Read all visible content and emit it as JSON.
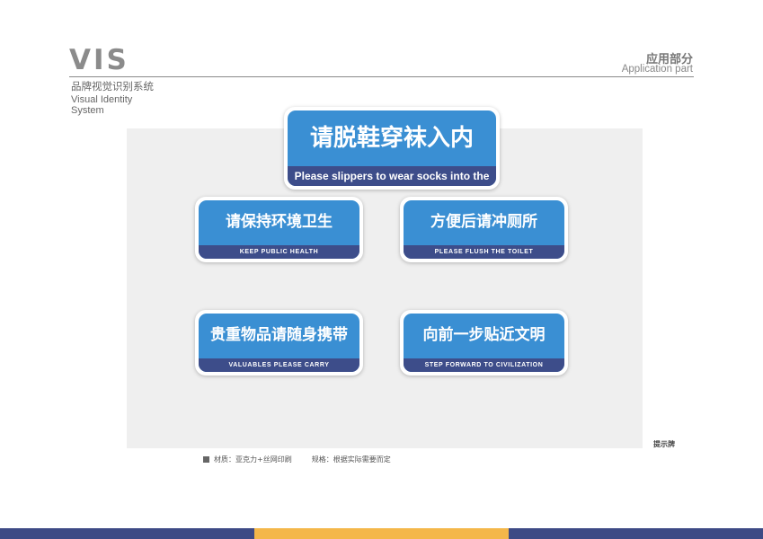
{
  "header": {
    "logo": "VIS",
    "subtitle_cn": "品牌视觉识别系统",
    "subtitle_en_1": "Visual Identity",
    "subtitle_en_2": "System",
    "section_cn": "应用部分",
    "section_en": "Application part"
  },
  "signs": [
    {
      "cn": "请脱鞋穿袜入内",
      "en": "Please slippers to wear socks into the"
    },
    {
      "cn": "请保持环境卫生",
      "en": "KEEP PUBLIC HEALTH"
    },
    {
      "cn": "方便后请冲厕所",
      "en": "PLEASE FLUSH THE TOILET"
    },
    {
      "cn": "贵重物品请随身携带",
      "en": "VALUABLES PLEASE CARRY"
    },
    {
      "cn": "向前一步贴近文明",
      "en": "STEP FORWARD TO CIVILIZATION"
    }
  ],
  "caption": "提示牌",
  "notes": {
    "material": "材质：亚克力+丝网印刷",
    "spec": "规格：根据实际需要而定"
  },
  "colors": {
    "sign_blue": "#3a8fd3",
    "band_navy": "#3d4d8a",
    "footer_navy": "#3d4a85",
    "footer_orange": "#f4b74a"
  }
}
